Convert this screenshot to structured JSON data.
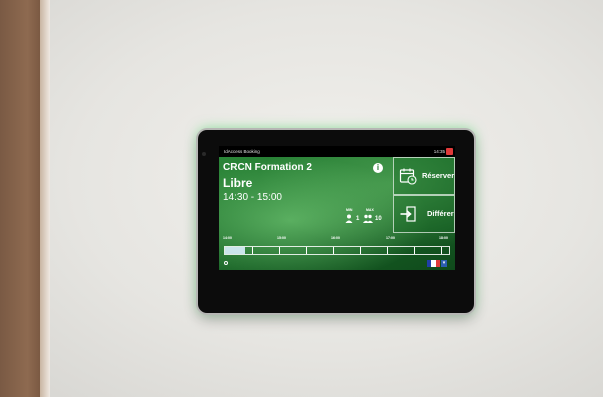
{
  "screen": {
    "app_name": "IdAccess Booking",
    "clock": "14:35",
    "room_name": "CRCN Formation 2",
    "status": "Libre",
    "time_range": "14:30 - 15:00",
    "info_icon": "i",
    "capacity": {
      "min_label": "MIN",
      "max_label": "MAX",
      "min_value": "1",
      "max_value": "10"
    },
    "actions": {
      "reserve_label": "Réserver",
      "defer_label": "Différer"
    },
    "timeline": {
      "ticks": [
        "14:00",
        "15:00",
        "16:00",
        "17:00",
        "18:00"
      ],
      "progress": 0.09
    },
    "language": {
      "flag_colors": [
        "#1f3fa8",
        "#ffffff",
        "#e03a3a"
      ],
      "dropdown_icon": "chevron-down-icon"
    }
  },
  "colors": {
    "accent_green": "#2d8a3a",
    "glow": "#5ae678",
    "alert_red": "#e03a3a"
  }
}
